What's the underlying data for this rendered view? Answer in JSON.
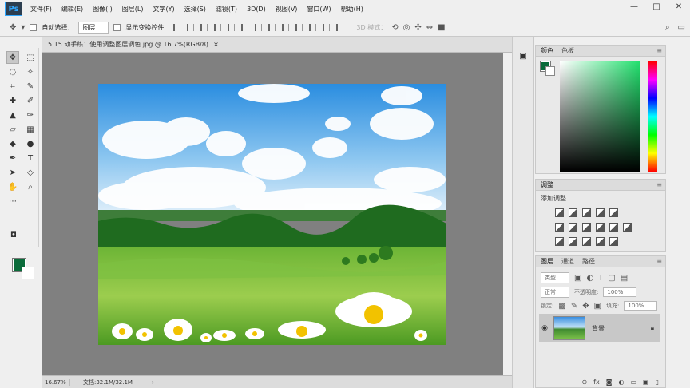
{
  "app": {
    "logo": "Ps"
  },
  "menu": [
    "文件(F)",
    "编辑(E)",
    "图像(I)",
    "图层(L)",
    "文字(Y)",
    "选择(S)",
    "滤镜(T)",
    "3D(D)",
    "视图(V)",
    "窗口(W)",
    "帮助(H)"
  ],
  "window_controls": {
    "minimize": "—",
    "maximize": "□",
    "close": "✕"
  },
  "options": {
    "auto_select_label": "自动选择：",
    "auto_select_value": "图层",
    "show_transform_label": "显示变换控件",
    "mode_3d_label": "3D 模式："
  },
  "document": {
    "tab_title": "5.15 动手练：使用调整图层调色.jpg @ 16.7%(RGB/8)",
    "tab_close": "×"
  },
  "status": {
    "zoom": "16.67%",
    "doc_size": "文档:32.1M/32.1M",
    "arrow": "›"
  },
  "color_panel": {
    "tabs": [
      "颜色",
      "色板"
    ],
    "fg_color": "#0a6b3a",
    "bg_color": "#ffffff"
  },
  "adjustments_panel": {
    "tab": "调整",
    "title": "添加调整"
  },
  "layers_panel": {
    "tabs": [
      "图层",
      "通道",
      "路径"
    ],
    "filter_placeholder": "类型",
    "blend_mode": "正常",
    "opacity_label": "不透明度:",
    "opacity_value": "100%",
    "lock_label": "锁定:",
    "fill_label": "填充:",
    "fill_value": "100%",
    "layers": [
      {
        "name": "背景"
      }
    ]
  }
}
